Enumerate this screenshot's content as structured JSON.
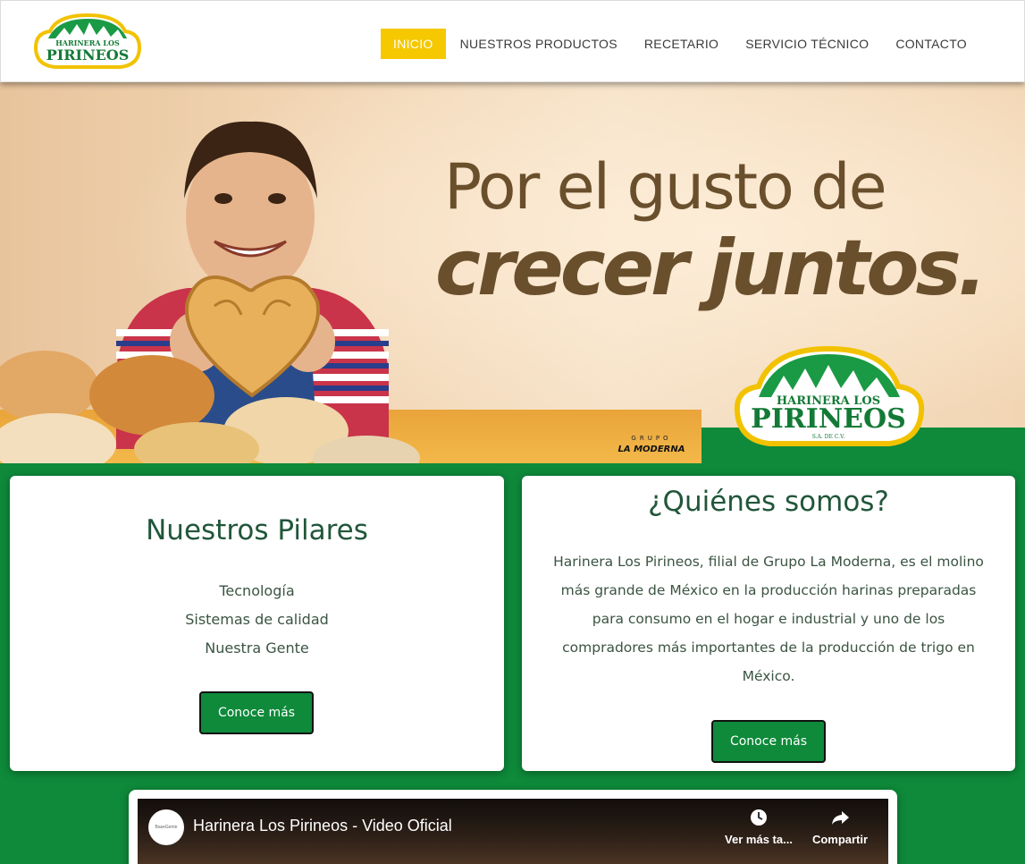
{
  "brand": {
    "logo_line1": "HARINERA LOS",
    "logo_line2": "PIRINEOS",
    "logo_sub": "S.A. DE C.V.",
    "group_logo_top": "GRUPO",
    "group_logo_bottom": "LA MODERNA"
  },
  "nav": {
    "items": [
      {
        "label": "INICIO",
        "active": true
      },
      {
        "label": "NUESTROS PRODUCTOS",
        "active": false
      },
      {
        "label": "RECETARIO",
        "active": false
      },
      {
        "label": "SERVICIO TÉCNICO",
        "active": false
      },
      {
        "label": "CONTACTO",
        "active": false
      }
    ]
  },
  "hero": {
    "line1": "Por el gusto de",
    "line2": "crecer juntos."
  },
  "pillars": {
    "title": "Nuestros Pilares",
    "items": [
      "Tecnología",
      "Sistemas de calidad",
      "Nuestra Gente"
    ],
    "button": "Conoce más"
  },
  "about": {
    "title": "¿Quiénes somos?",
    "lines": [
      "Harinera Los Pirineos, filial de Grupo La Moderna, es el molino",
      "más grande de México en la producción harinas preparadas",
      "para consumo en el hogar e industrial y uno de los",
      "compradores más importantes de la producción de trigo en",
      "México."
    ],
    "button": "Conoce más"
  },
  "video": {
    "title": "Harinera Los Pirineos - Video Oficial",
    "watch_later": "Ver más ta...",
    "share": "Compartir",
    "channel_icon": "BaseGente"
  },
  "colors": {
    "brand_green": "#0e8a3a",
    "active_nav": "#f5c800",
    "title_green": "#21563a",
    "headline_brown": "#6a4f2c"
  }
}
